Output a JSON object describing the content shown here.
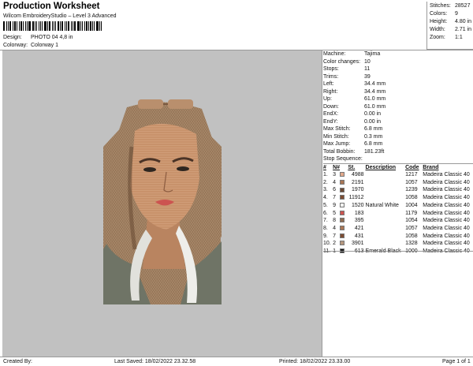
{
  "header": {
    "title": "Production Worksheet",
    "software": "Wilcom EmbroideryStudio – Level 3 Advanced",
    "design_label": "Design:",
    "design_value": "PHOTO 04 4,8 in",
    "colorway_label": "Colorway:",
    "colorway_value": "Colorway 1"
  },
  "summary": [
    {
      "label": "Stitches:",
      "value": "28527"
    },
    {
      "label": "Colors:",
      "value": "9"
    },
    {
      "label": "Height:",
      "value": "4.80 in"
    },
    {
      "label": "Width:",
      "value": "2.71 in"
    },
    {
      "label": "Zoom:",
      "value": "1:1"
    }
  ],
  "machine_info": [
    {
      "label": "Machine:",
      "value": "Tajima"
    },
    {
      "label": "Color changes:",
      "value": "10"
    },
    {
      "label": "Stops:",
      "value": "11"
    },
    {
      "label": "Trims:",
      "value": "39"
    },
    {
      "label": "Left:",
      "value": "34.4 mm"
    },
    {
      "label": "Right:",
      "value": "34.4 mm"
    },
    {
      "label": "Up:",
      "value": "61.0 mm"
    },
    {
      "label": "Down:",
      "value": "61.0 mm"
    },
    {
      "label": "EndX:",
      "value": "0.00 in"
    },
    {
      "label": "EndY:",
      "value": "0.00 in"
    },
    {
      "label": "Max Stitch:",
      "value": "6.8 mm"
    },
    {
      "label": "Min Stitch:",
      "value": "0.3 mm"
    },
    {
      "label": "Max Jump:",
      "value": "6.8 mm"
    },
    {
      "label": "Total Bobbin:",
      "value": "181.23ft"
    }
  ],
  "stop_sequence": {
    "title": "Stop Sequence:",
    "headers": {
      "no": "#",
      "n": "N#",
      "st": "St.",
      "desc": "Description",
      "code": "Code",
      "brand": "Brand"
    },
    "rows": [
      {
        "no": "1.",
        "n": "3",
        "color": "#e2a98c",
        "st": "4988",
        "desc": "",
        "code": "1217",
        "brand": "Madeira Classic 40"
      },
      {
        "no": "2.",
        "n": "4",
        "color": "#a97656",
        "st": "2191",
        "desc": "",
        "code": "1057",
        "brand": "Madeira Classic 40"
      },
      {
        "no": "3.",
        "n": "6",
        "color": "#6b4a36",
        "st": "1970",
        "desc": "",
        "code": "1239",
        "brand": "Madeira Classic 40"
      },
      {
        "no": "4.",
        "n": "7",
        "color": "#7d4d33",
        "st": "11912",
        "desc": "",
        "code": "1058",
        "brand": "Madeira Classic 40"
      },
      {
        "no": "5.",
        "n": "9",
        "color": "#f3f3f1",
        "st": "1520",
        "desc": "Natural White",
        "code": "1004",
        "brand": "Madeira Classic 40"
      },
      {
        "no": "6.",
        "n": "5",
        "color": "#cc5450",
        "st": "183",
        "desc": "",
        "code": "1179",
        "brand": "Madeira Classic 40"
      },
      {
        "no": "7.",
        "n": "8",
        "color": "#8f6d54",
        "st": "395",
        "desc": "",
        "code": "1054",
        "brand": "Madeira Classic 40"
      },
      {
        "no": "8.",
        "n": "4",
        "color": "#a97656",
        "st": "421",
        "desc": "",
        "code": "1057",
        "brand": "Madeira Classic 40"
      },
      {
        "no": "9.",
        "n": "7",
        "color": "#7d4d33",
        "st": "431",
        "desc": "",
        "code": "1058",
        "brand": "Madeira Classic 40"
      },
      {
        "no": "10.",
        "n": "2",
        "color": "#b5977f",
        "st": "3901",
        "desc": "",
        "code": "1328",
        "brand": "Madeira Classic 40"
      },
      {
        "no": "11.",
        "n": "1",
        "color": "#141414",
        "st": "613",
        "desc": "Emerald Black",
        "code": "1000",
        "brand": "Madeira Classic 40"
      }
    ]
  },
  "footer": {
    "created_by": "Created By:",
    "last_saved": "Last Saved: 18/02/2022 23.32.58",
    "printed": "Printed: 18/02/2022 23.33.00",
    "page": "Page 1 of 1"
  },
  "colors": {
    "canvas_bg": "#c1c1c1",
    "hair": "#8a6a4e",
    "skin": "#c8926b",
    "jacket": "#6f7466"
  }
}
